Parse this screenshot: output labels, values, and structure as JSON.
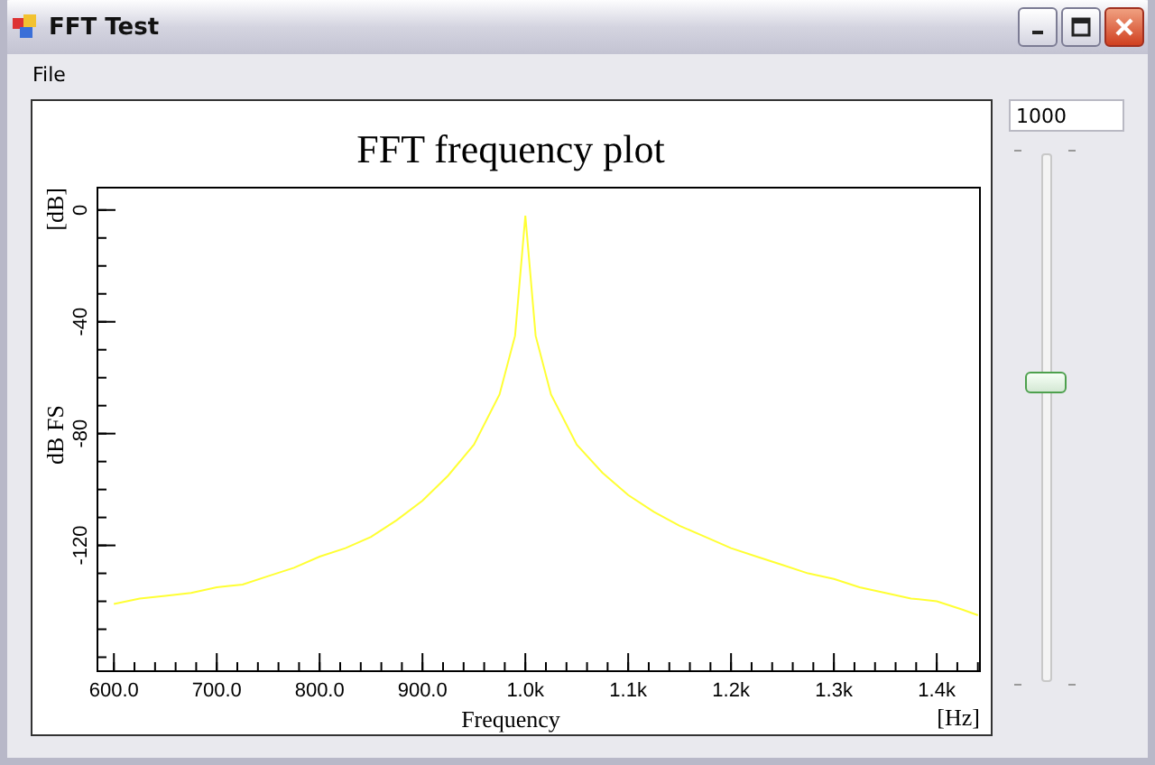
{
  "window": {
    "title": "FFT Test"
  },
  "menu": [
    {
      "label": "File"
    }
  ],
  "plot": {
    "x_unit": "[Hz]",
    "y_unit": "[dB]",
    "chart_data": {
      "type": "line",
      "title": "FFT frequency plot",
      "xlabel": "Frequency",
      "ylabel": "dB FS",
      "x": [
        600,
        625,
        650,
        675,
        700,
        725,
        750,
        775,
        800,
        825,
        850,
        875,
        900,
        925,
        950,
        975,
        990,
        1000,
        1010,
        1025,
        1050,
        1075,
        1100,
        1125,
        1150,
        1175,
        1200,
        1225,
        1250,
        1275,
        1300,
        1325,
        1350,
        1375,
        1400,
        1425,
        1440
      ],
      "series": [
        {
          "color": "#ffff33",
          "values": [
            -141,
            -139,
            -138,
            -137,
            -135,
            -134,
            -131,
            -128,
            -124,
            -121,
            -117,
            -111,
            -104,
            -95,
            -84,
            -66,
            -45,
            -2,
            -45,
            -66,
            -84,
            -94,
            -102,
            -108,
            -113,
            -117,
            -121,
            -124,
            -127,
            -130,
            -132,
            -135,
            -137,
            -139,
            -140,
            -143,
            -145
          ]
        }
      ],
      "xlim": [
        584,
        1442
      ],
      "ylim": [
        -165,
        8
      ],
      "xticks": [
        {
          "value": 600,
          "label": "600.0"
        },
        {
          "value": 700,
          "label": "700.0"
        },
        {
          "value": 800,
          "label": "800.0"
        },
        {
          "value": 900,
          "label": "900.0"
        },
        {
          "value": 1000,
          "label": "1.0k"
        },
        {
          "value": 1100,
          "label": "1.1k"
        },
        {
          "value": 1200,
          "label": "1.2k"
        },
        {
          "value": 1300,
          "label": "1.3k"
        },
        {
          "value": 1400,
          "label": "1.4k"
        }
      ],
      "yticks": [
        0,
        -40,
        -80,
        -120
      ]
    }
  },
  "value_field": {
    "value": "1000"
  },
  "slider": {
    "level": 0.56
  }
}
